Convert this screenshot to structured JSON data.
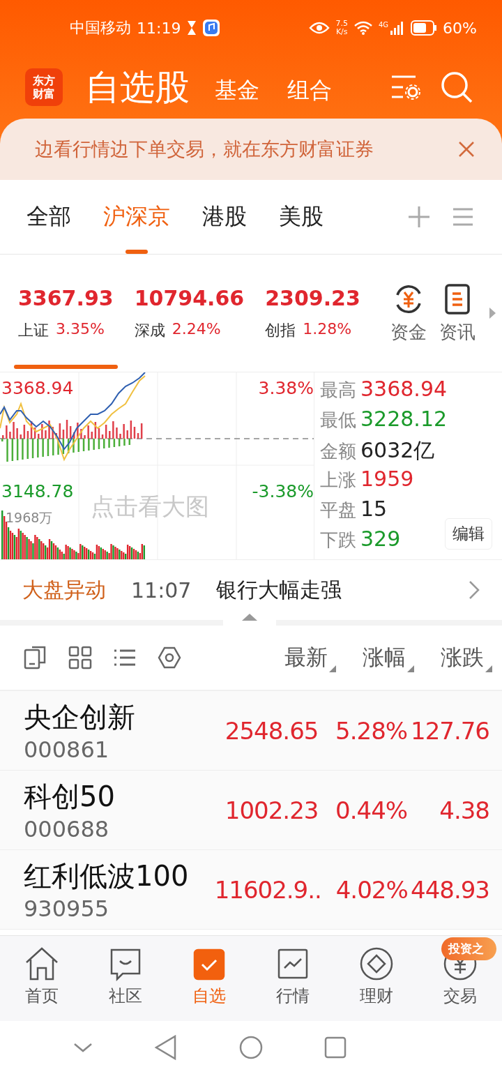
{
  "status_bar": {
    "carrier": "中国移动",
    "time": "11:19",
    "speed": "7.5\nK/s",
    "network": "4G",
    "battery": "60%"
  },
  "header": {
    "logo": "东方财富",
    "title": "自选股",
    "links": [
      "基金",
      "组合"
    ]
  },
  "banner": {
    "text": "边看行情边下单交易，就在东方财富证券"
  },
  "tabs": [
    {
      "label": "全部",
      "selected": false
    },
    {
      "label": "沪深京",
      "selected": true
    },
    {
      "label": "港股",
      "selected": false
    },
    {
      "label": "美股",
      "selected": false
    }
  ],
  "indices": [
    {
      "value": "3367.93",
      "name": "上证",
      "change": "3.35%",
      "color": "#e0262e",
      "selected": true
    },
    {
      "value": "10794.66",
      "name": "深成",
      "change": "2.24%",
      "color": "#e0262e",
      "selected": false
    },
    {
      "value": "2309.23",
      "name": "创指",
      "change": "1.28%",
      "color": "#e0262e",
      "selected": false
    }
  ],
  "index_actions": [
    {
      "kind": "funds",
      "label": "资金"
    },
    {
      "kind": "news",
      "label": "资讯"
    }
  ],
  "chart": {
    "high_label": "3368.94",
    "low_label": "3148.78",
    "high_pct": "3.38%",
    "low_pct": "-3.38%",
    "volume": "1968万",
    "overlay": "点击看大图"
  },
  "stats": [
    {
      "label": "最高",
      "value": "3368.94",
      "color": "#e0262e"
    },
    {
      "label": "最低",
      "value": "3228.12",
      "color": "#1a9a2a"
    },
    {
      "label": "金额",
      "value": "6032亿",
      "color": "#222222"
    },
    {
      "label": "上涨",
      "value": "1959",
      "color": "#e0262e"
    },
    {
      "label": "平盘",
      "value": "15",
      "color": "#222222"
    },
    {
      "label": "下跌",
      "value": "329",
      "color": "#1a9a2a"
    }
  ],
  "edit_button": "编辑",
  "market_alert": {
    "label": "大盘异动",
    "time": "11:07",
    "text": "银行大幅走强"
  },
  "list_header": {
    "columns": [
      "最新",
      "涨幅",
      "涨跌"
    ]
  },
  "stocks": [
    {
      "name": "央企创新",
      "code": "000861",
      "price": "2548.65",
      "change_pct": "5.28%",
      "change": "127.76",
      "color": "#e0262e"
    },
    {
      "name": "科创50",
      "code": "000688",
      "price": "1002.23",
      "change_pct": "0.44%",
      "change": "4.38",
      "color": "#e0262e"
    },
    {
      "name": "红利低波100",
      "code": "930955",
      "price": "11602.9..",
      "change_pct": "4.02%",
      "change": "448.93",
      "color": "#e0262e"
    }
  ],
  "bottom_nav": [
    {
      "kind": "home",
      "label": "首页",
      "selected": false
    },
    {
      "kind": "community",
      "label": "社区",
      "selected": false
    },
    {
      "kind": "watchlist",
      "label": "自选",
      "selected": true
    },
    {
      "kind": "market",
      "label": "行情",
      "selected": false
    },
    {
      "kind": "wealth",
      "label": "理财",
      "selected": false
    },
    {
      "kind": "trade",
      "label": "交易",
      "selected": false
    }
  ],
  "promo_badge": "投资之"
}
